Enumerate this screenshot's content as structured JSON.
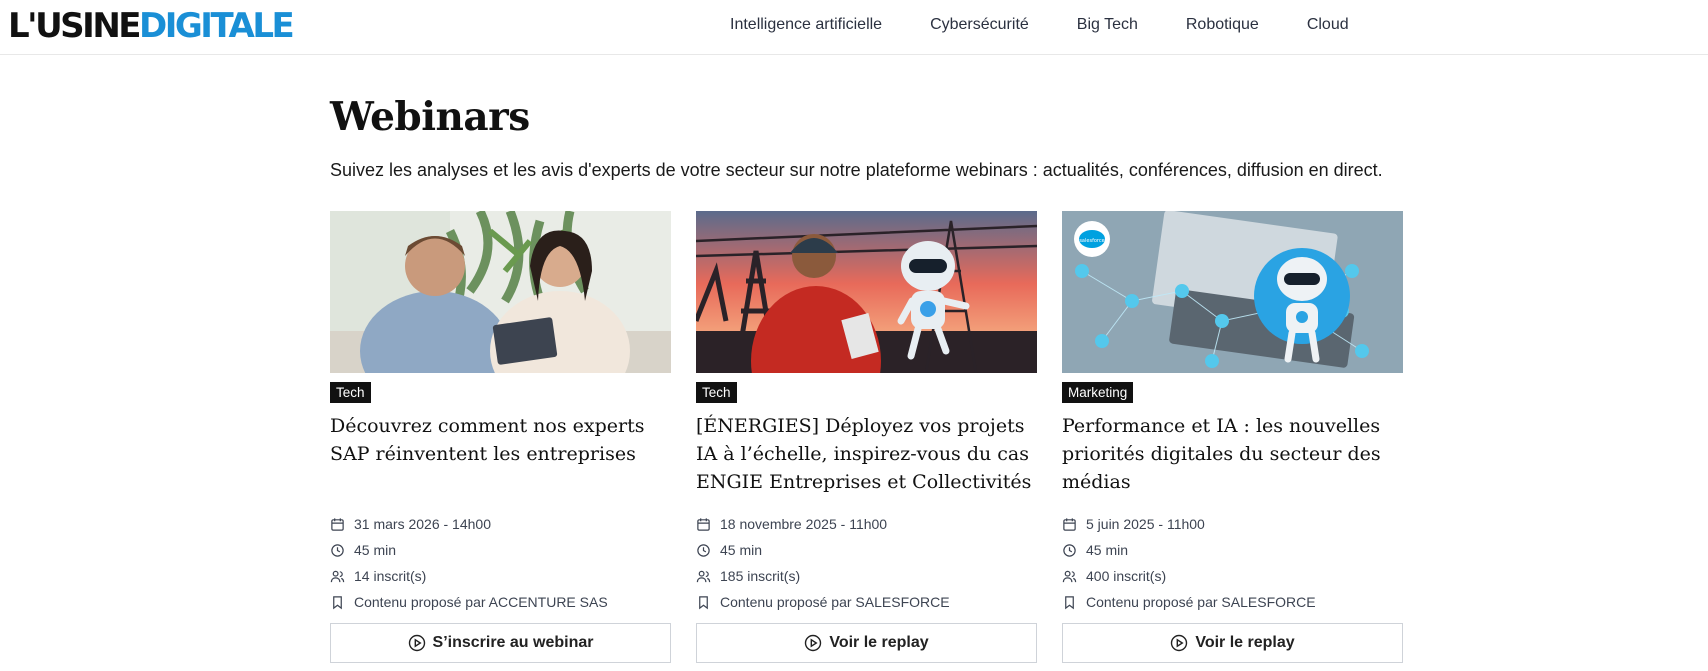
{
  "header": {
    "logo_part1": "L'USINE",
    "logo_part2": "DIGITALE",
    "nav": [
      "Intelligence artificielle",
      "Cybersécurité",
      "Big Tech",
      "Robotique",
      "Cloud"
    ]
  },
  "page": {
    "title": "Webinars",
    "intro": "Suivez les analyses et les avis d'experts de votre secteur sur notre plateforme webinars : actualités, conférences, diffusion en direct."
  },
  "cards": [
    {
      "tag": "Tech",
      "title": "Découvrez comment nos experts SAP réinventent les entreprises",
      "date": "31 mars 2026 - 14h00",
      "duration": "45 min",
      "registered": "14 inscrit(s)",
      "sponsor": "Contenu proposé par ACCENTURE SAS",
      "button": "S’inscrire au webinar"
    },
    {
      "tag": "Tech",
      "title": "[ÉNERGIES] Déployez vos projets IA à l’échelle, inspirez-vous du cas ENGIE Entreprises et Collectivités",
      "date": "18 novembre 2025 - 11h00",
      "duration": "45 min",
      "registered": "185 inscrit(s)",
      "sponsor": "Contenu proposé par SALESFORCE",
      "button": "Voir le replay"
    },
    {
      "tag": "Marketing",
      "title": "Performance et IA : les nouvelles priorités digitales du secteur des médias",
      "date": "5 juin 2025 - 11h00",
      "duration": "45 min",
      "registered": "400 inscrit(s)",
      "sponsor": "Contenu proposé par SALESFORCE",
      "button": "Voir le replay",
      "image_logo": "salesforce"
    }
  ],
  "icons": {
    "date": "calendar-icon",
    "duration": "clock-icon",
    "registered": "users-icon",
    "sponsor": "bookmark-icon",
    "button": "play-circle-icon"
  },
  "colors": {
    "brand_blue": "#1a8fd6",
    "tag_bg": "#111111"
  }
}
